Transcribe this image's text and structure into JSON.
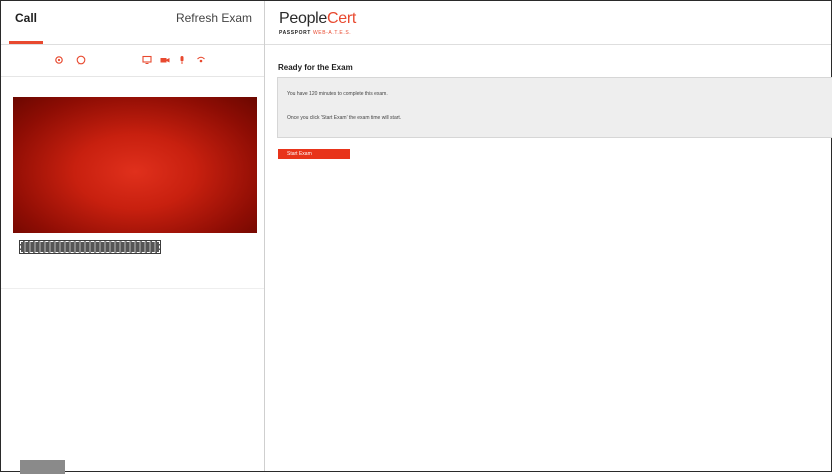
{
  "left_panel": {
    "tabs": {
      "call_label": "Call",
      "refresh_label": "Refresh Exam"
    },
    "toolbar_icons": [
      "settings-icon",
      "chat-icon",
      "screen-share-icon",
      "camera-icon",
      "microphone-icon",
      "broadcast-icon"
    ]
  },
  "right_panel": {
    "logo": {
      "part1": "People",
      "part2": "Cert",
      "sub_bold": "PASSPORT",
      "sub_rest": "WEB-A.T.E.S."
    },
    "exam": {
      "title": "Ready for the Exam",
      "line1": "You have 120 minutes to complete this exam.",
      "line2": "Once you click 'Start Exam' the exam time will start.",
      "start_label": "Start Exam"
    }
  },
  "colors": {
    "accent": "#e8492f",
    "button": "#e8341a"
  }
}
